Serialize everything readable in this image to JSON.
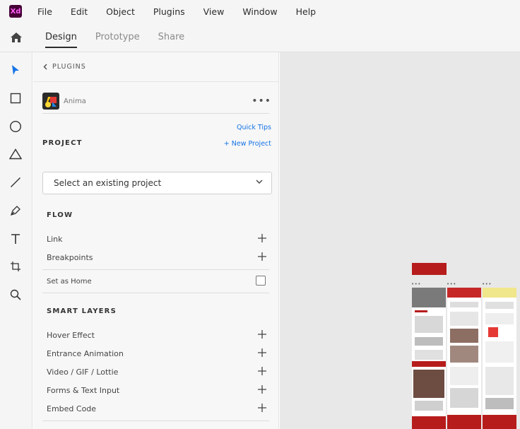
{
  "app": {
    "logo_text": "Xd",
    "menu": [
      "File",
      "Edit",
      "Object",
      "Plugins",
      "View",
      "Window",
      "Help"
    ]
  },
  "modes": {
    "tabs": [
      "Design",
      "Prototype",
      "Share"
    ],
    "active": "Design"
  },
  "tools": [
    "select-tool",
    "rectangle-tool",
    "ellipse-tool",
    "polygon-tool",
    "line-tool",
    "pen-tool",
    "text-tool",
    "artboard-tool",
    "zoom-tool"
  ],
  "panel": {
    "header": "PLUGINS",
    "plugin_name": "Anima",
    "quick_tips": "Quick Tips",
    "project_title": "PROJECT",
    "new_project": "+ New Project",
    "project_select": "Select an existing project",
    "flow": {
      "title": "FLOW",
      "items": [
        "Link",
        "Breakpoints"
      ],
      "set_home": "Set as Home"
    },
    "smart_layers": {
      "title": "SMART LAYERS",
      "items": [
        "Hover Effect",
        "Entrance Animation",
        "Video / GIF / Lottie",
        "Forms & Text Input",
        "Embed Code"
      ]
    }
  },
  "colors": {
    "accent": "#1473e6",
    "brand_red": "#b71c1c",
    "xd_logo_bg": "#470137",
    "xd_logo_fg": "#ff61f6",
    "select_tool": "#1473e6"
  }
}
